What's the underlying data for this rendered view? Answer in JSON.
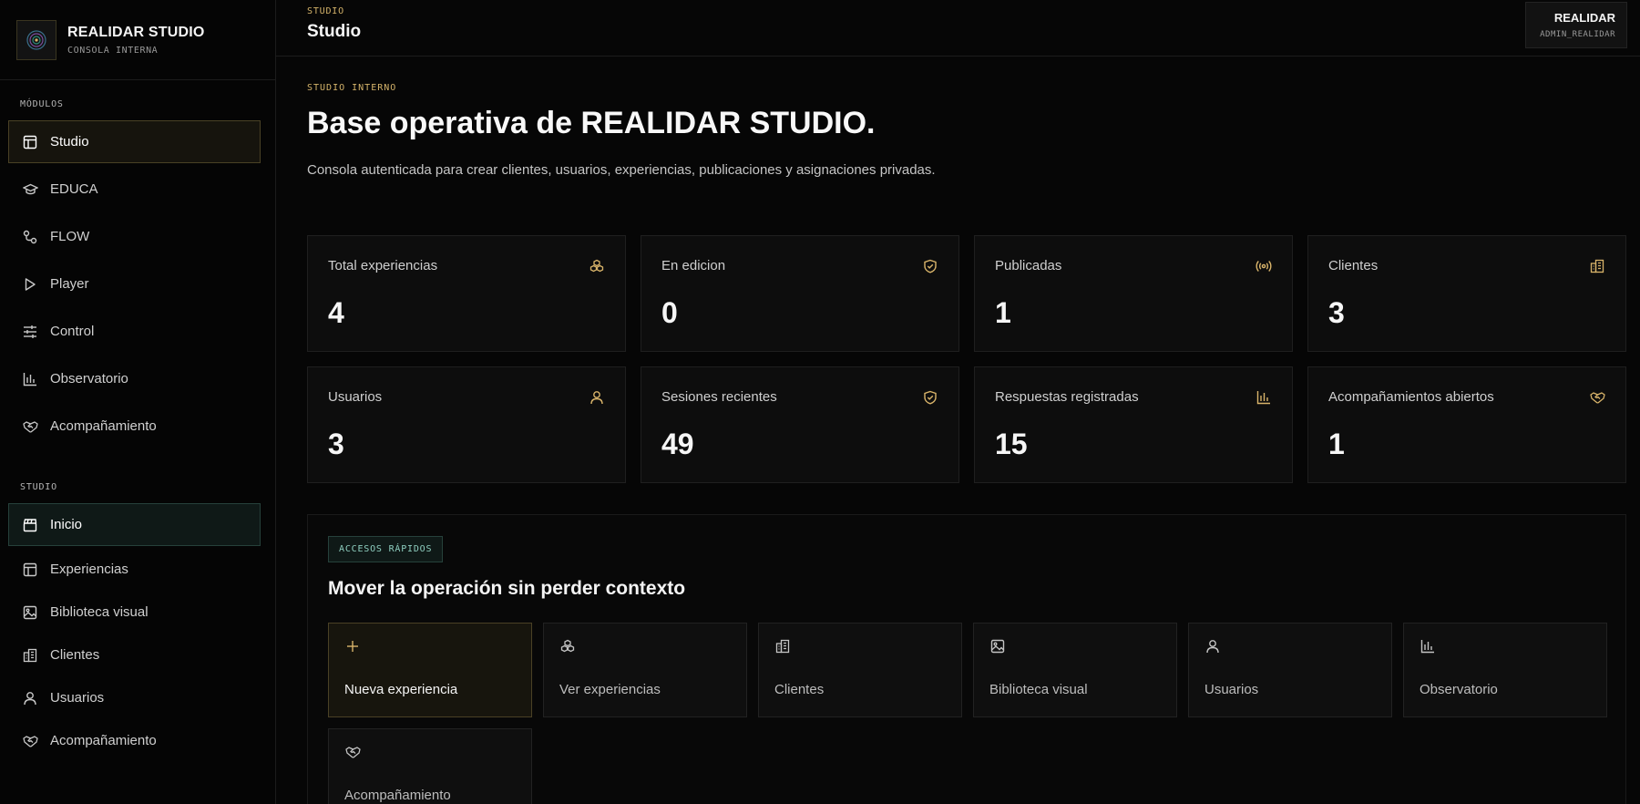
{
  "brand": {
    "title": "REALIDAR STUDIO",
    "subtitle": "CONSOLA INTERNA"
  },
  "sidebar": {
    "modules_label": "MÓDULOS",
    "modules": [
      {
        "label": "Studio",
        "icon": "layout-icon"
      },
      {
        "label": "EDUCA",
        "icon": "graduation-cap-icon"
      },
      {
        "label": "FLOW",
        "icon": "flow-icon"
      },
      {
        "label": "Player",
        "icon": "play-icon"
      },
      {
        "label": "Control",
        "icon": "sliders-icon"
      },
      {
        "label": "Observatorio",
        "icon": "bar-chart-icon"
      },
      {
        "label": "Acompañamiento",
        "icon": "handshake-icon"
      }
    ],
    "studio_label": "STUDIO",
    "studio": [
      {
        "label": "Inicio",
        "icon": "clapperboard-icon"
      },
      {
        "label": "Experiencias",
        "icon": "layout-icon"
      },
      {
        "label": "Biblioteca visual",
        "icon": "image-icon"
      },
      {
        "label": "Clientes",
        "icon": "building-icon"
      },
      {
        "label": "Usuarios",
        "icon": "user-icon"
      },
      {
        "label": "Acompañamiento",
        "icon": "handshake-icon"
      }
    ]
  },
  "topbar": {
    "eyebrow": "STUDIO",
    "title": "Studio"
  },
  "user": {
    "name": "REALIDAR",
    "role": "ADMIN_REALIDAR"
  },
  "hero": {
    "eyebrow": "STUDIO INTERNO",
    "title": "Base operativa de REALIDAR STUDIO.",
    "description": "Consola autenticada para crear clientes, usuarios, experiencias, publicaciones y asignaciones privadas."
  },
  "stats": [
    {
      "label": "Total experiencias",
      "value": "4",
      "icon": "cubes-icon"
    },
    {
      "label": "En edicion",
      "value": "0",
      "icon": "shield-check-icon"
    },
    {
      "label": "Publicadas",
      "value": "1",
      "icon": "broadcast-icon"
    },
    {
      "label": "Clientes",
      "value": "3",
      "icon": "building-icon"
    },
    {
      "label": "Usuarios",
      "value": "3",
      "icon": "user-icon"
    },
    {
      "label": "Sesiones recientes",
      "value": "49",
      "icon": "shield-check-icon"
    },
    {
      "label": "Respuestas registradas",
      "value": "15",
      "icon": "bar-chart-icon"
    },
    {
      "label": "Acompañamientos abiertos",
      "value": "1",
      "icon": "handshake-icon"
    }
  ],
  "quick": {
    "badge": "ACCESOS RÁPIDOS",
    "title": "Mover la operación sin perder contexto",
    "tiles": [
      {
        "label": "Nueva experiencia",
        "icon": "plus-icon"
      },
      {
        "label": "Ver experiencias",
        "icon": "cubes-icon"
      },
      {
        "label": "Clientes",
        "icon": "building-icon"
      },
      {
        "label": "Biblioteca visual",
        "icon": "image-icon"
      },
      {
        "label": "Usuarios",
        "icon": "user-icon"
      },
      {
        "label": "Observatorio",
        "icon": "bar-chart-icon"
      },
      {
        "label": "Acompañamiento",
        "icon": "handshake-icon"
      }
    ]
  },
  "colors": {
    "accent": "#d9b46a",
    "teal": "#8fcfc0",
    "background": "#060606"
  }
}
